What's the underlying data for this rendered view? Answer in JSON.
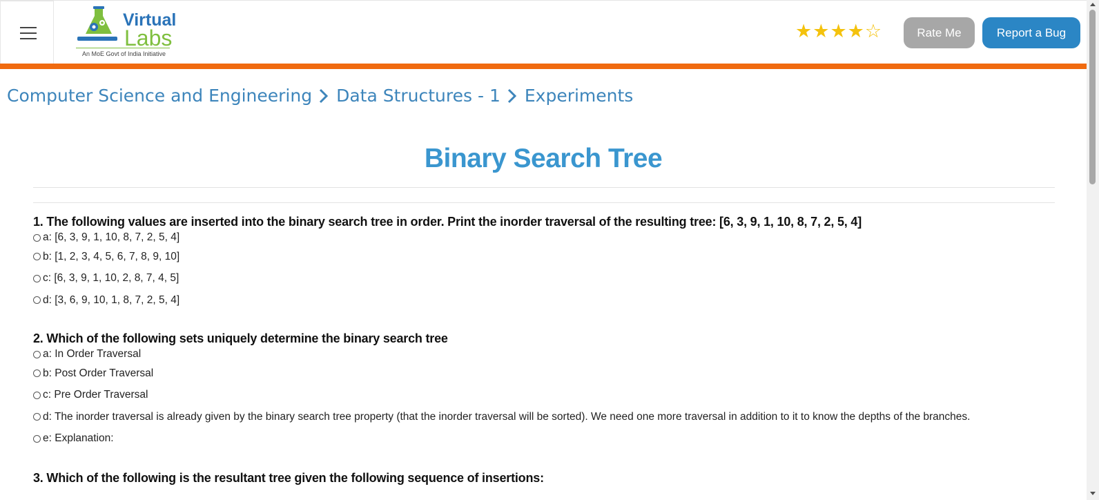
{
  "header": {
    "menu_icon": "hamburger-menu-icon",
    "logo": {
      "word1": "Virtual",
      "word2": "Labs",
      "tagline": "An MoE Govt of India Initiative"
    },
    "rating": {
      "value": 4,
      "max": 5,
      "filled_color": "#f4c20d"
    },
    "rate_button": "Rate Me",
    "report_button": "Report a Bug",
    "accent_bar_color": "#f06a0f"
  },
  "breadcrumb": {
    "items": [
      "Computer Science and Engineering",
      "Data Structures - 1",
      "Experiments"
    ],
    "separator_icon": "chevron-right-icon"
  },
  "page": {
    "title": "Binary Search Tree"
  },
  "questions": [
    {
      "text": "1. The following values are inserted into the binary search tree in order. Print the inorder traversal of the resulting tree: [6, 3, 9, 1, 10, 8, 7, 2, 5, 4]",
      "options": [
        "a: [6, 3, 9, 1, 10, 8, 7, 2, 5, 4]",
        "b: [1, 2, 3, 4, 5, 6, 7, 8, 9, 10]",
        "c: [6, 3, 9, 1, 10, 2, 8, 7, 4, 5]",
        "d: [3, 6, 9, 10, 1, 8, 7, 2, 5, 4]"
      ]
    },
    {
      "text": "2. Which of the following sets uniquely determine the binary search tree",
      "options": [
        "a: In Order Traversal",
        "b: Post Order Traversal",
        "c: Pre Order Traversal",
        "d: The inorder traversal is already given by the binary search tree property (that the inorder traversal will be sorted). We need one more traversal in addition to it to know the depths of the branches.",
        "e: Explanation:"
      ]
    },
    {
      "text": "3. Which of the following is the resultant tree given the following sequence of insertions:",
      "options": []
    }
  ]
}
